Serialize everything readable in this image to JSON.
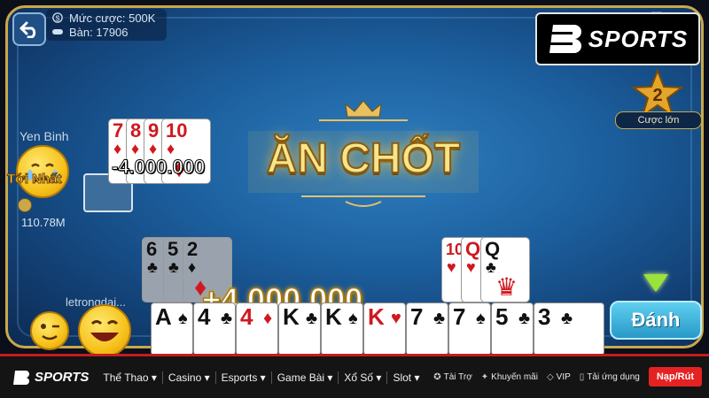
{
  "room": {
    "bet_label": "Mức cược: 500K",
    "table_label": "Bàn: 17906"
  },
  "brand": {
    "logo_text": "SPORTS"
  },
  "badge": {
    "level": "2",
    "label": "Cược lớn"
  },
  "banner": {
    "text": "ĂN CHỐT"
  },
  "opponent": {
    "name": "Yen Binh",
    "money": "110.78M",
    "status_text": "Tới Nhất",
    "meld": [
      {
        "rank": "7",
        "suit": "♦",
        "color": "red"
      },
      {
        "rank": "8",
        "suit": "♦",
        "color": "red"
      },
      {
        "rank": "9",
        "suit": "♦",
        "color": "red"
      },
      {
        "rank": "10",
        "suit": "♦",
        "color": "red"
      }
    ],
    "penalty": "-4.000.000"
  },
  "player": {
    "name": "letrongdai...",
    "bonus": "+4.000.000",
    "meld": [
      {
        "rank": "6",
        "suit": "♣",
        "color": "blk"
      },
      {
        "rank": "5",
        "suit": "♣",
        "color": "blk"
      },
      {
        "rank": "2",
        "suit": "♦",
        "color": "red"
      }
    ]
  },
  "center_meld": [
    {
      "rank": "10",
      "suit": "♥",
      "color": "red"
    },
    {
      "rank": "Q",
      "suit": "♥",
      "color": "red"
    },
    {
      "rank": "Q",
      "suit": "♣",
      "color": "blk"
    }
  ],
  "hand": [
    {
      "rank": "A",
      "suit": "♠",
      "color": "blk"
    },
    {
      "rank": "4",
      "suit": "♣",
      "color": "blk"
    },
    {
      "rank": "4",
      "suit": "♦",
      "color": "red"
    },
    {
      "rank": "K",
      "suit": "♣",
      "color": "blk"
    },
    {
      "rank": "K",
      "suit": "♠",
      "color": "blk"
    },
    {
      "rank": "K",
      "suit": "♥",
      "color": "red"
    },
    {
      "rank": "7",
      "suit": "♣",
      "color": "blk"
    },
    {
      "rank": "7",
      "suit": "♠",
      "color": "blk"
    },
    {
      "rank": "5",
      "suit": "♣",
      "color": "blk"
    },
    {
      "rank": "3",
      "suit": "♣",
      "color": "blk"
    }
  ],
  "actions": {
    "play_label": "Đánh"
  },
  "nav": {
    "logo_text": "SPORTS",
    "items": [
      "Thể Thao ▾",
      "Casino ▾",
      "Esports ▾",
      "Game Bài ▾",
      "Xổ Số ▾",
      "Slot ▾"
    ],
    "links": [
      "Tài Trợ",
      "Khuyến mãi",
      "VIP",
      "Tải ứng dụng"
    ],
    "cta": "Nạp/Rút"
  },
  "colors": {
    "gold": "#c9a84a",
    "table_blue": "#1c5f9e",
    "nav_red": "#e52222"
  }
}
